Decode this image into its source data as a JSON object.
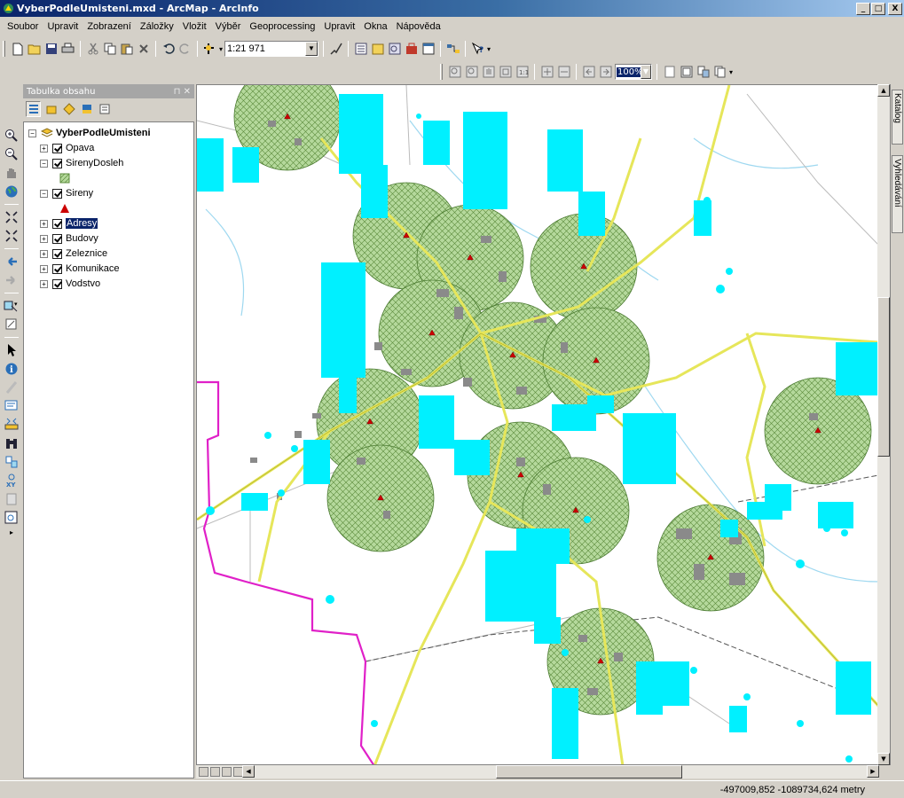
{
  "window": {
    "title": "VyberPodleUmisteni.mxd - ArcMap - ArcInfo",
    "buttons": {
      "minimize": "_",
      "maximize": "□",
      "close": "X"
    }
  },
  "menu": [
    "Soubor",
    "Upravit",
    "Zobrazení",
    "Záložky",
    "Vložit",
    "Výběr",
    "Geoprocessing",
    "Upravit",
    "Okna",
    "Nápověda"
  ],
  "toolbar": {
    "scale_value": "1:21 971",
    "layout_zoom_value": "100%"
  },
  "toc": {
    "title": "Tabulka obsahu",
    "root": "VyberPodleUmisteni",
    "layers": [
      {
        "name": "Opava",
        "checked": true,
        "expanded": false
      },
      {
        "name": "SirenyDosleh",
        "checked": true,
        "expanded": true
      },
      {
        "name": "Sireny",
        "checked": true,
        "expanded": true
      },
      {
        "name": "Adresy",
        "checked": true,
        "expanded": false,
        "selected": true
      },
      {
        "name": "Budovy",
        "checked": true,
        "expanded": false
      },
      {
        "name": "Zeleznice",
        "checked": true,
        "expanded": false
      },
      {
        "name": "Komunikace",
        "checked": true,
        "expanded": false
      },
      {
        "name": "Vodstvo",
        "checked": true,
        "expanded": false
      }
    ]
  },
  "dock_tabs": [
    "Katalog",
    "Vyhledávání"
  ],
  "status": {
    "coordinates": "-497009,852  -1089734,624 metry"
  },
  "colors": {
    "buffer_fill": "#b5d99c",
    "buffer_stroke": "#5a8a3a",
    "address_points": "#00f0ff",
    "roads": "#e6e65a",
    "boundary": "#e020c8",
    "siren": "#cc0000",
    "buildings": "#8a8a8a",
    "water": "#9ed8f0"
  }
}
